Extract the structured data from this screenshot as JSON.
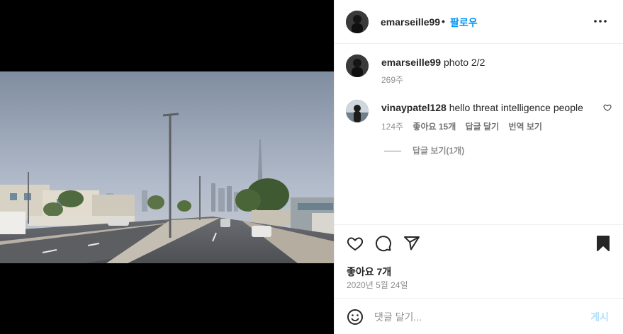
{
  "header": {
    "username": "emarseille99",
    "separator": "•",
    "follow_label": "팔로우"
  },
  "caption": {
    "username": "emarseille99",
    "text": "photo 2/2",
    "time": "269주"
  },
  "comments": [
    {
      "username": "vinaypatel128",
      "text": "hello threat intelligence people",
      "time": "124주",
      "likes": "좋아요 15개",
      "reply_label": "답글 달기",
      "translate_label": "번역 보기",
      "view_replies_label": "답글 보기(1개)"
    }
  ],
  "footer": {
    "likes_text": "좋아요 7개",
    "date_text": "2020년 5월 24일",
    "comment_placeholder": "댓글 달기...",
    "post_label": "게시"
  },
  "icons": {
    "more": "more-options-icon",
    "like": "heart-icon",
    "comment": "comment-icon",
    "share": "share-icon",
    "save": "bookmark-icon",
    "emoji": "emoji-icon",
    "comment_like": "heart-icon"
  },
  "colors": {
    "accent": "#0095f6",
    "post_disabled": "#b2dffc",
    "muted": "#8e8e8e",
    "border": "#efefef"
  }
}
